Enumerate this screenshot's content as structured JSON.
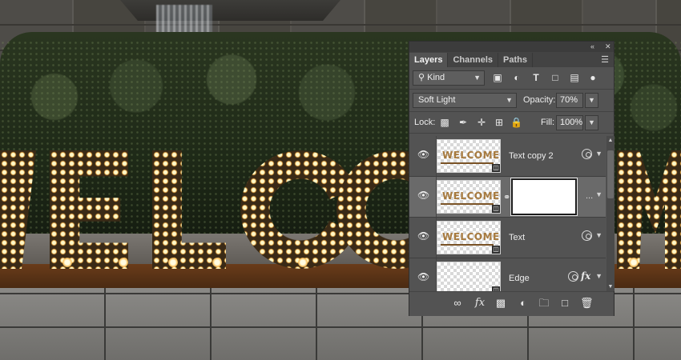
{
  "panel": {
    "tabs": [
      {
        "label": "Layers",
        "active": true
      },
      {
        "label": "Channels",
        "active": false
      },
      {
        "label": "Paths",
        "active": false
      }
    ],
    "filter": {
      "kind_label": "Kind"
    },
    "blend_mode": "Soft Light",
    "opacity_label": "Opacity:",
    "opacity_value": "70%",
    "lock_label": "Lock:",
    "fill_label": "Fill:",
    "fill_value": "100%",
    "layers": [
      {
        "name": "Text copy 2",
        "thumb_text": "WELCOME",
        "selected": false,
        "has_mask": false,
        "has_fx": false
      },
      {
        "name": "",
        "thumb_text": "WELCOME",
        "selected": true,
        "has_mask": true,
        "has_fx": false,
        "more": "..."
      },
      {
        "name": "Text",
        "thumb_text": "WELCOME",
        "selected": false,
        "has_mask": false,
        "has_fx": false
      },
      {
        "name": "Edge",
        "thumb_text": "",
        "selected": false,
        "has_mask": false,
        "has_fx": true,
        "fx": "fx"
      }
    ],
    "footer_icons": [
      "link-layers-icon",
      "fx-icon",
      "add-mask-icon",
      "adjustment-layer-icon",
      "group-folder-icon",
      "new-layer-icon",
      "delete-icon"
    ]
  },
  "colors": {
    "panel_bg": "#535353",
    "selected_row": "#6a6a6a",
    "bulb_glow": "#f4b450"
  }
}
